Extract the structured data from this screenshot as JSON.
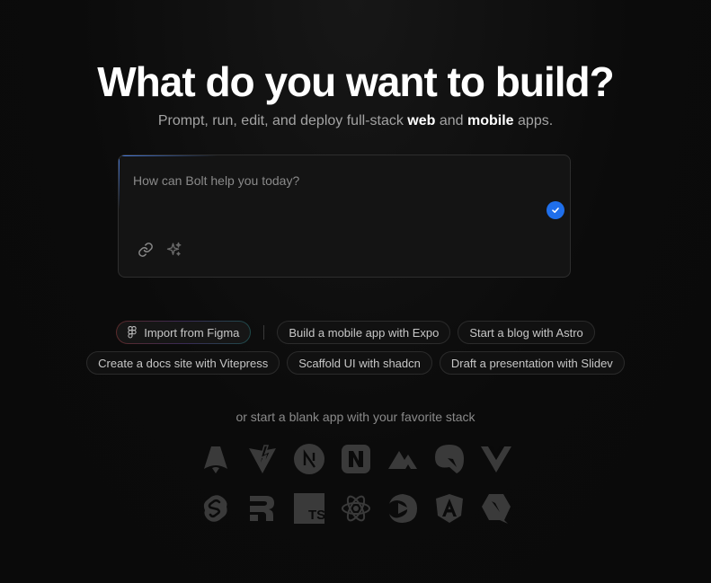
{
  "hero": {
    "title": "What do you want to build?",
    "subtitle_pre": "Prompt, run, edit, and deploy full-stack ",
    "subtitle_web": "web",
    "subtitle_mid": " and ",
    "subtitle_mobile": "mobile",
    "subtitle_post": " apps."
  },
  "prompt": {
    "placeholder": "How can Bolt help you today?",
    "value": ""
  },
  "suggestions": {
    "row1": [
      "Import from Figma",
      "Build a mobile app with Expo",
      "Start a blog with Astro"
    ],
    "row2": [
      "Create a docs site with Vitepress",
      "Scaffold UI with shadcn",
      "Draft a presentation with Slidev"
    ]
  },
  "starters": {
    "label": "or start a blank app with your favorite stack",
    "row1": [
      "astro-icon",
      "vite-icon",
      "nextjs-icon",
      "nuxt-icon",
      "nuxt-mountain-icon",
      "qwik-icon",
      "vue-icon"
    ],
    "row2": [
      "svelte-icon",
      "remix-icon",
      "typescript-icon",
      "react-icon",
      "slidev-icon",
      "angular-icon",
      "qwik-alt-icon"
    ]
  },
  "colors": {
    "background": "#0a0a0a",
    "accent": "#1f6feb",
    "logo": "#3a3a3a"
  }
}
